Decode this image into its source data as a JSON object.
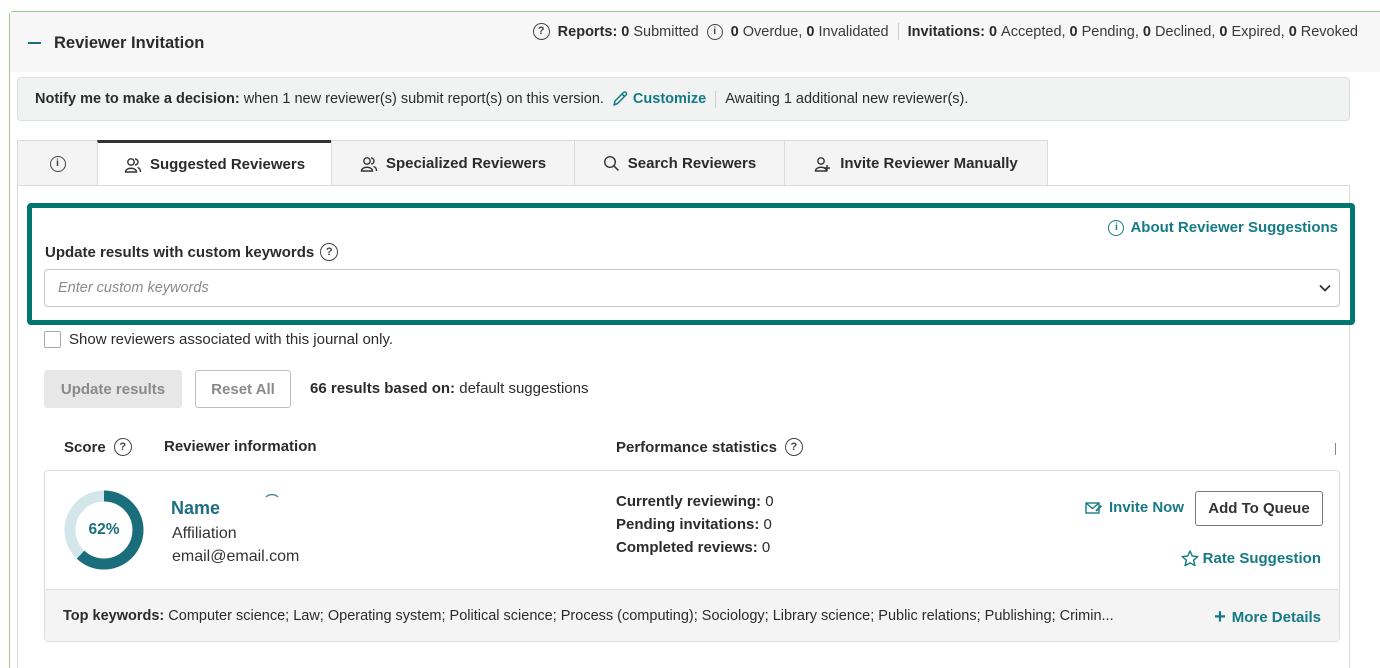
{
  "section": {
    "title": "Reviewer Invitation",
    "reports_label": "Reports:",
    "submitted_count": "0",
    "submitted_label": "Submitted",
    "overdue_count": "0",
    "overdue_label": "Overdue,",
    "invalidated_count": "0",
    "invalidated_label": "Invalidated",
    "invitations_label": "Invitations:",
    "accepted_count": "0",
    "accepted_label": "Accepted,",
    "pending_count": "0",
    "pending_label": "Pending,",
    "declined_count": "0",
    "declined_label": "Declined,",
    "expired_count": "0",
    "expired_label": "Expired,",
    "revoked_count": "0",
    "revoked_label": "Revoked"
  },
  "notify": {
    "label": "Notify me to make a decision:",
    "text": "when 1 new reviewer(s) submit report(s) on this version.",
    "customize": "Customize",
    "awaiting": "Awaiting 1 additional new reviewer(s)."
  },
  "tabs": [
    {
      "label": ""
    },
    {
      "label": "Suggested Reviewers"
    },
    {
      "label": "Specialized Reviewers"
    },
    {
      "label": "Search Reviewers"
    },
    {
      "label": "Invite Reviewer Manually"
    }
  ],
  "keywords": {
    "about": "About Reviewer Suggestions",
    "label": "Update results with custom keywords",
    "placeholder": "Enter custom keywords"
  },
  "filter": {
    "checkbox_label": "Show reviewers associated with this journal only.",
    "update_button": "Update results",
    "reset_button": "Reset All",
    "results_count": "66 results based on:",
    "results_basis": "default suggestions"
  },
  "columns": {
    "score": "Score",
    "info": "Reviewer information",
    "stats": "Performance statistics"
  },
  "reviewer": {
    "score_text": "62%",
    "score_value": 0.62,
    "name": "Name",
    "affiliation": "Affiliation",
    "email": "email@email.com",
    "currently_label": "Currently reviewing:",
    "currently_value": "0",
    "pending_label": "Pending invitations:",
    "pending_value": "0",
    "completed_label": "Completed reviews:",
    "completed_value": "0",
    "invite_now": "Invite Now",
    "add_queue": "Add To Queue",
    "rate": "Rate Suggestion",
    "top_keywords_label": "Top keywords:",
    "top_keywords": "Computer science; Law; Operating system; Political science; Process (computing); Sociology; Library science; Public relations; Publishing; Crimin...",
    "more_details": "More Details"
  },
  "colors": {
    "accent": "#157a86",
    "highlight_border": "#00766f",
    "outer_border": "#9ccc8d"
  }
}
